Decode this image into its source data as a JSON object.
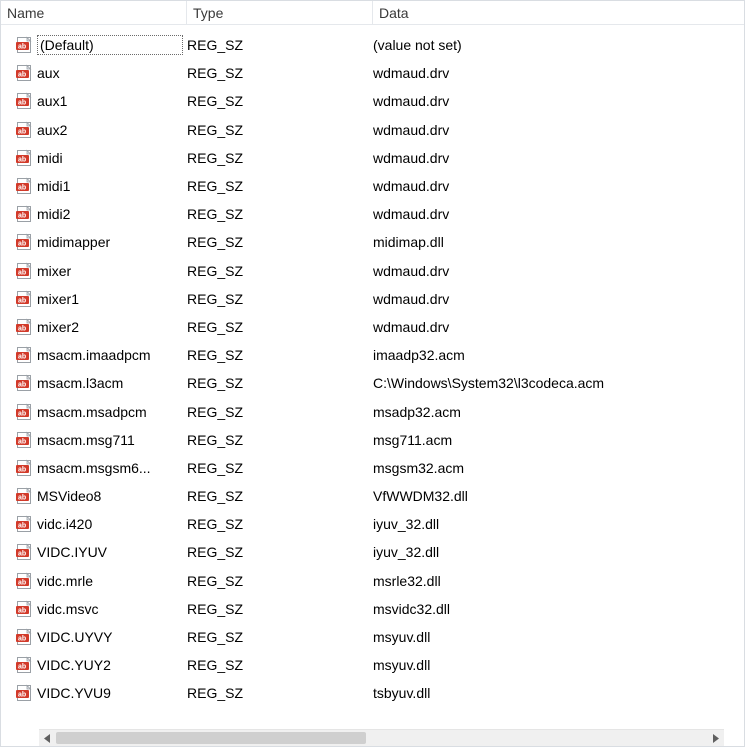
{
  "columns": {
    "name": "Name",
    "type": "Type",
    "data": "Data"
  },
  "rows": [
    {
      "name": "(Default)",
      "type": "REG_SZ",
      "data": "(value not set)",
      "selected": true
    },
    {
      "name": "aux",
      "type": "REG_SZ",
      "data": "wdmaud.drv"
    },
    {
      "name": "aux1",
      "type": "REG_SZ",
      "data": "wdmaud.drv"
    },
    {
      "name": "aux2",
      "type": "REG_SZ",
      "data": "wdmaud.drv"
    },
    {
      "name": "midi",
      "type": "REG_SZ",
      "data": "wdmaud.drv"
    },
    {
      "name": "midi1",
      "type": "REG_SZ",
      "data": "wdmaud.drv"
    },
    {
      "name": "midi2",
      "type": "REG_SZ",
      "data": "wdmaud.drv"
    },
    {
      "name": "midimapper",
      "type": "REG_SZ",
      "data": "midimap.dll"
    },
    {
      "name": "mixer",
      "type": "REG_SZ",
      "data": "wdmaud.drv"
    },
    {
      "name": "mixer1",
      "type": "REG_SZ",
      "data": "wdmaud.drv"
    },
    {
      "name": "mixer2",
      "type": "REG_SZ",
      "data": "wdmaud.drv"
    },
    {
      "name": "msacm.imaadpcm",
      "type": "REG_SZ",
      "data": "imaadp32.acm"
    },
    {
      "name": "msacm.l3acm",
      "type": "REG_SZ",
      "data": "C:\\Windows\\System32\\l3codeca.acm"
    },
    {
      "name": "msacm.msadpcm",
      "type": "REG_SZ",
      "data": "msadp32.acm"
    },
    {
      "name": "msacm.msg711",
      "type": "REG_SZ",
      "data": "msg711.acm"
    },
    {
      "name": "msacm.msgsm6...",
      "type": "REG_SZ",
      "data": "msgsm32.acm"
    },
    {
      "name": "MSVideo8",
      "type": "REG_SZ",
      "data": "VfWWDM32.dll"
    },
    {
      "name": "vidc.i420",
      "type": "REG_SZ",
      "data": "iyuv_32.dll"
    },
    {
      "name": "VIDC.IYUV",
      "type": "REG_SZ",
      "data": "iyuv_32.dll"
    },
    {
      "name": "vidc.mrle",
      "type": "REG_SZ",
      "data": "msrle32.dll"
    },
    {
      "name": "vidc.msvc",
      "type": "REG_SZ",
      "data": "msvidc32.dll"
    },
    {
      "name": "VIDC.UYVY",
      "type": "REG_SZ",
      "data": "msyuv.dll"
    },
    {
      "name": "VIDC.YUY2",
      "type": "REG_SZ",
      "data": "msyuv.dll"
    },
    {
      "name": "VIDC.YVU9",
      "type": "REG_SZ",
      "data": "tsbyuv.dll"
    }
  ]
}
